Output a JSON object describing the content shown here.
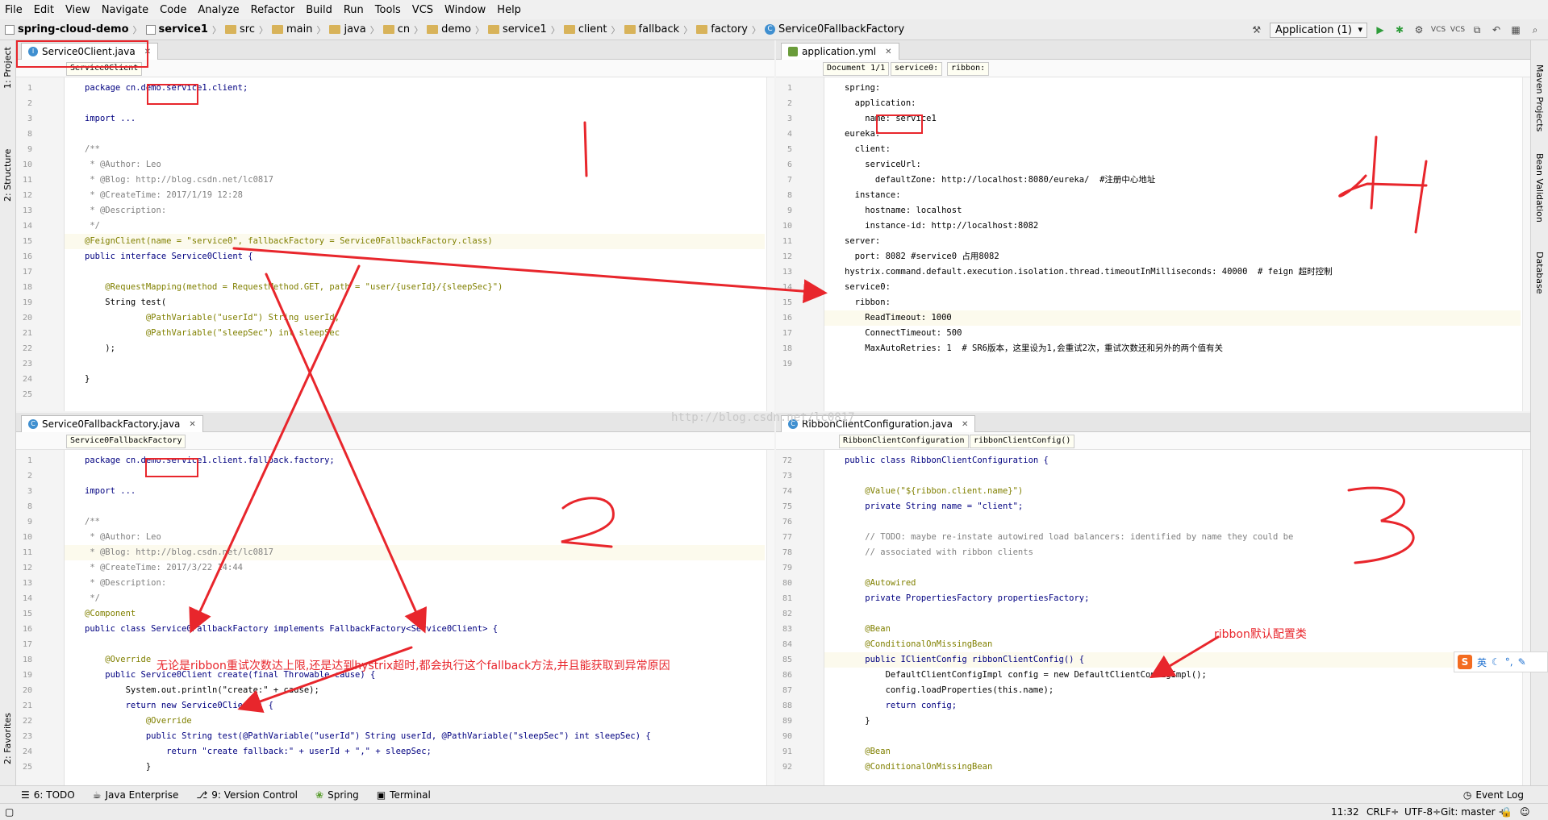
{
  "menu": [
    "File",
    "Edit",
    "View",
    "Navigate",
    "Code",
    "Analyze",
    "Refactor",
    "Build",
    "Run",
    "Tools",
    "VCS",
    "Window",
    "Help"
  ],
  "breadcrumbs": [
    "spring-cloud-demo",
    "service1",
    "src",
    "main",
    "java",
    "cn",
    "demo",
    "service1",
    "client",
    "fallback",
    "factory",
    "Service0FallbackFactory"
  ],
  "run_config": "Application (1)",
  "left_tools": {
    "project": "1: Project",
    "structure": "2: Structure",
    "favorites": "2: Favorites"
  },
  "right_tools": {
    "maven": "Maven Projects",
    "bean": "Bean Validation",
    "database": "Database"
  },
  "watermark": "http://blog.csdn.net/lc0817",
  "panes": {
    "top_left": {
      "tab": "Service0Client.java",
      "breadcrumb": [
        "Service0Client"
      ],
      "lines": [
        {
          "n": "1",
          "t": "package cn.demo.service1.client;"
        },
        {
          "n": "2",
          "t": ""
        },
        {
          "n": "3",
          "t": "import ..."
        },
        {
          "n": "8",
          "t": ""
        },
        {
          "n": "9",
          "t": "/**"
        },
        {
          "n": "10",
          "t": " * @Author: Leo"
        },
        {
          "n": "11",
          "t": " * @Blog: http://blog.csdn.net/lc0817"
        },
        {
          "n": "12",
          "t": " * @CreateTime: 2017/1/19 12:28"
        },
        {
          "n": "13",
          "t": " * @Description:"
        },
        {
          "n": "14",
          "t": " */"
        },
        {
          "n": "15",
          "t": "@FeignClient(name = \"service0\", fallbackFactory = Service0FallbackFactory.class)"
        },
        {
          "n": "16",
          "t": "public interface Service0Client {"
        },
        {
          "n": "17",
          "t": ""
        },
        {
          "n": "18",
          "t": "    @RequestMapping(method = RequestMethod.GET, path = \"user/{userId}/{sleepSec}\")"
        },
        {
          "n": "19",
          "t": "    String test("
        },
        {
          "n": "20",
          "t": "            @PathVariable(\"userId\") String userId,"
        },
        {
          "n": "21",
          "t": "            @PathVariable(\"sleepSec\") int sleepSec"
        },
        {
          "n": "22",
          "t": "    );"
        },
        {
          "n": "23",
          "t": ""
        },
        {
          "n": "24",
          "t": "}"
        },
        {
          "n": "25",
          "t": ""
        }
      ]
    },
    "top_right": {
      "tab": "application.yml",
      "breadcrumb": [
        "Document 1/1",
        "service0:",
        "ribbon:"
      ],
      "lines": [
        {
          "n": "1",
          "t": "spring:"
        },
        {
          "n": "2",
          "t": "  application:"
        },
        {
          "n": "3",
          "t": "    name: service1"
        },
        {
          "n": "4",
          "t": "eureka:"
        },
        {
          "n": "5",
          "t": "  client:"
        },
        {
          "n": "6",
          "t": "    serviceUrl:"
        },
        {
          "n": "7",
          "t": "      defaultZone: http://localhost:8080/eureka/  #注册中心地址"
        },
        {
          "n": "8",
          "t": "  instance:"
        },
        {
          "n": "9",
          "t": "    hostname: localhost"
        },
        {
          "n": "10",
          "t": "    instance-id: http://localhost:8082"
        },
        {
          "n": "11",
          "t": "server:"
        },
        {
          "n": "12",
          "t": "  port: 8082 #service0 占用8082"
        },
        {
          "n": "13",
          "t": "hystrix.command.default.execution.isolation.thread.timeoutInMilliseconds: 40000  # feign 超时控制"
        },
        {
          "n": "14",
          "t": "service0:"
        },
        {
          "n": "15",
          "t": "  ribbon:"
        },
        {
          "n": "16",
          "t": "    ReadTimeout: 1000"
        },
        {
          "n": "17",
          "t": "    ConnectTimeout: 500"
        },
        {
          "n": "18",
          "t": "    MaxAutoRetries: 1  # SR6版本，这里设为1,会重试2次，重试次数还和另外的两个值有关"
        },
        {
          "n": "19",
          "t": ""
        }
      ]
    },
    "bottom_left": {
      "tab": "Service0FallbackFactory.java",
      "breadcrumb": [
        "Service0FallbackFactory"
      ],
      "lines": [
        {
          "n": "1",
          "t": "package cn.demo.service1.client.fallback.factory;"
        },
        {
          "n": "2",
          "t": ""
        },
        {
          "n": "3",
          "t": "import ..."
        },
        {
          "n": "8",
          "t": ""
        },
        {
          "n": "9",
          "t": "/**"
        },
        {
          "n": "10",
          "t": " * @Author: Leo"
        },
        {
          "n": "11",
          "t": " * @Blog: http://blog.csdn.net/lc0817"
        },
        {
          "n": "12",
          "t": " * @CreateTime: 2017/3/22 14:44"
        },
        {
          "n": "13",
          "t": " * @Description:"
        },
        {
          "n": "14",
          "t": " */"
        },
        {
          "n": "15",
          "t": "@Component"
        },
        {
          "n": "16",
          "t": "public class Service0FallbackFactory implements FallbackFactory<Service0Client> {"
        },
        {
          "n": "17",
          "t": ""
        },
        {
          "n": "18",
          "t": "    @Override"
        },
        {
          "n": "19",
          "t": "    public Service0Client create(final Throwable cause) {"
        },
        {
          "n": "20",
          "t": "        System.out.println(\"create:\" + cause);"
        },
        {
          "n": "21",
          "t": "        return new Service0Client() {"
        },
        {
          "n": "22",
          "t": "            @Override"
        },
        {
          "n": "23",
          "t": "            public String test(@PathVariable(\"userId\") String userId, @PathVariable(\"sleepSec\") int sleepSec) {"
        },
        {
          "n": "24",
          "t": "                return \"create fallback:\" + userId + \",\" + sleepSec;"
        },
        {
          "n": "25",
          "t": "            }"
        }
      ]
    },
    "bottom_right": {
      "tab": "RibbonClientConfiguration.java",
      "breadcrumb": [
        "RibbonClientConfiguration",
        "ribbonClientConfig()"
      ],
      "lines": [
        {
          "n": "72",
          "t": "public class RibbonClientConfiguration {"
        },
        {
          "n": "73",
          "t": ""
        },
        {
          "n": "74",
          "t": "    @Value(\"${ribbon.client.name}\")"
        },
        {
          "n": "75",
          "t": "    private String name = \"client\";"
        },
        {
          "n": "76",
          "t": ""
        },
        {
          "n": "77",
          "t": "    // TODO: maybe re-instate autowired load balancers: identified by name they could be"
        },
        {
          "n": "78",
          "t": "    // associated with ribbon clients"
        },
        {
          "n": "79",
          "t": ""
        },
        {
          "n": "80",
          "t": "    @Autowired"
        },
        {
          "n": "81",
          "t": "    private PropertiesFactory propertiesFactory;"
        },
        {
          "n": "82",
          "t": ""
        },
        {
          "n": "83",
          "t": "    @Bean"
        },
        {
          "n": "84",
          "t": "    @ConditionalOnMissingBean"
        },
        {
          "n": "85",
          "t": "    public IClientConfig ribbonClientConfig() {"
        },
        {
          "n": "86",
          "t": "        DefaultClientConfigImpl config = new DefaultClientConfigImpl();"
        },
        {
          "n": "87",
          "t": "        config.loadProperties(this.name);"
        },
        {
          "n": "88",
          "t": "        return config;"
        },
        {
          "n": "89",
          "t": "    }"
        },
        {
          "n": "90",
          "t": ""
        },
        {
          "n": "91",
          "t": "    @Bean"
        },
        {
          "n": "92",
          "t": "    @ConditionalOnMissingBean"
        }
      ]
    }
  },
  "annotations": {
    "n1": "1",
    "n2": "2",
    "n3": "3",
    "n4": "4",
    "fallback_note": "无论是ribbon重试次数达上限,还是达到hystrix超时,都会执行这个fallback方法,并且能获取到异常原因",
    "ribbon_note": "ribbon默认配置类"
  },
  "ime": "英",
  "bottom_tools": [
    "6: TODO",
    "Java Enterprise",
    "9: Version Control",
    "Spring",
    "Terminal"
  ],
  "event_log": "Event Log",
  "status": {
    "position": "11:32",
    "line_sep": "CRLF÷",
    "encoding": "UTF-8÷",
    "git": "Git: master ÷"
  },
  "colors": {
    "annotation_red": "#e8262c",
    "keyword": "#000080",
    "string": "#008000",
    "annotation": "#808000"
  }
}
